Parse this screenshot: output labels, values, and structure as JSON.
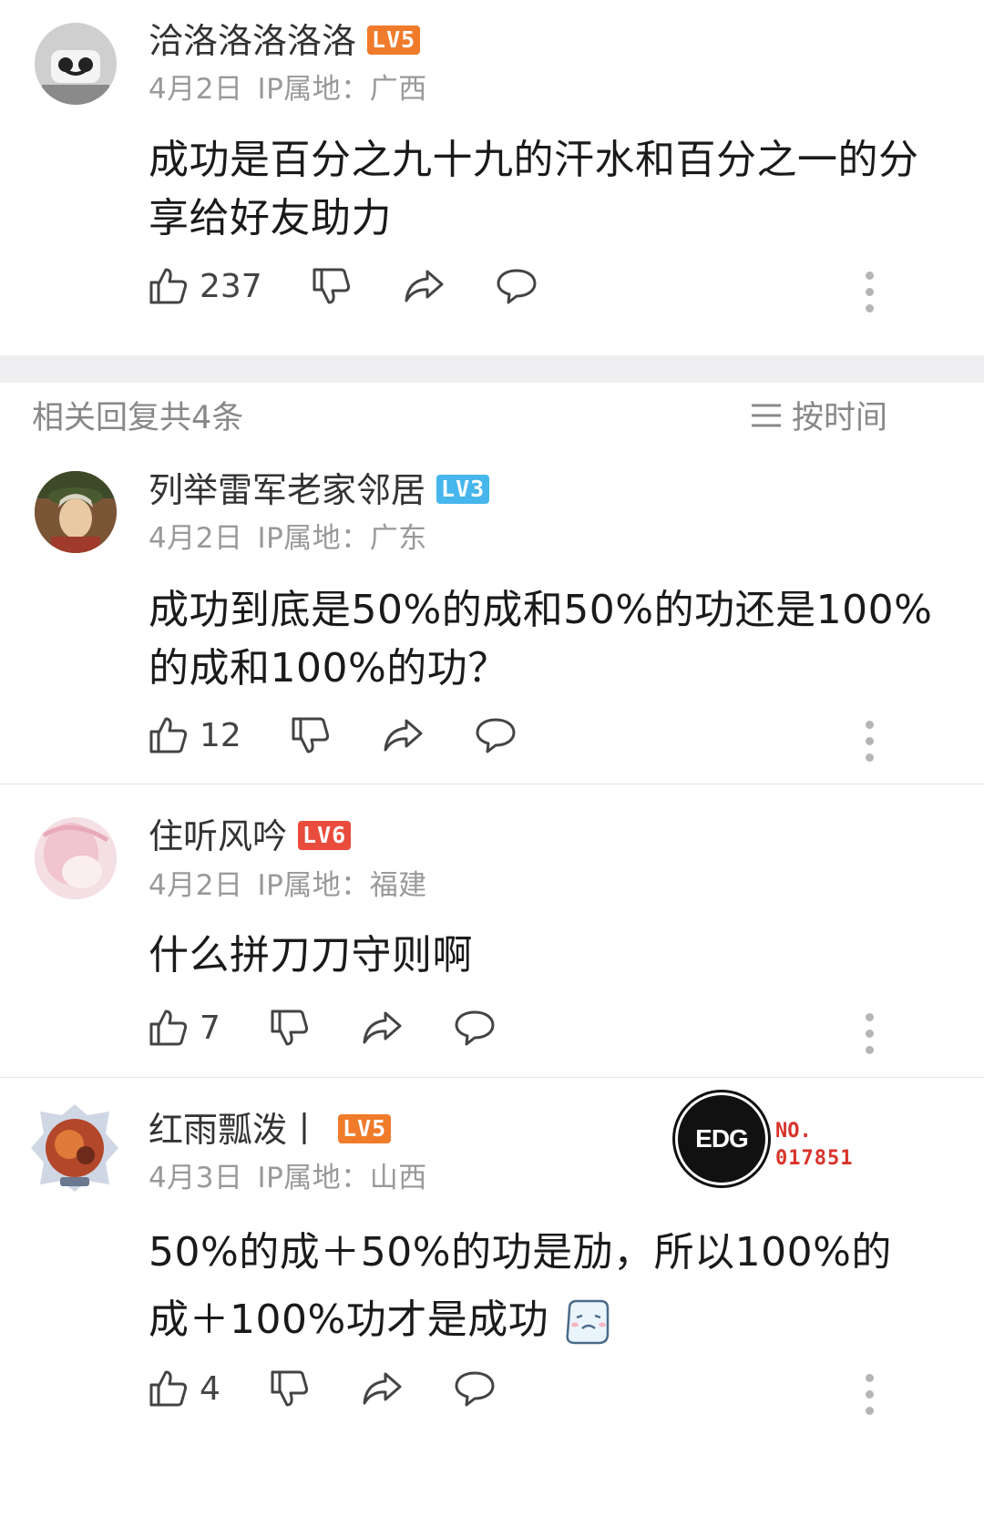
{
  "top_comment": {
    "username": "洽洛洛洛洛洛",
    "level": "LV5",
    "date": "4月2日",
    "ip_location": "IP属地：广西",
    "text": "成功是百分之九十九的汗水和百分之一的分享给好友助力",
    "likes": "237"
  },
  "replies_header": {
    "count_label": "相关回复共4条",
    "sort_label": "按时间"
  },
  "replies": [
    {
      "username": "列举雷军老家邻居",
      "level": "LV3",
      "date": "4月2日",
      "ip_location": "IP属地：广东",
      "text": "成功到底是50%的成和50%的功还是100%的成和100%的功？",
      "likes": "12"
    },
    {
      "username": "住听风吟",
      "level": "LV6",
      "date": "4月2日",
      "ip_location": "IP属地：福建",
      "text": "什么拼刀刀守则啊",
      "likes": "7"
    },
    {
      "username": "红雨瓢泼丨",
      "level": "LV5",
      "date": "4月3日",
      "ip_location": "IP属地：山西",
      "text": "50%的成＋50%的功是劢，所以100%的成＋100%功才是成功",
      "likes": "4",
      "badge_logo_text": "EDG",
      "badge_no_label": "NO.",
      "badge_no_value": "017851"
    }
  ],
  "colors": {
    "lv5": "#f07b2b",
    "lv3": "#46b6ec",
    "lv6": "#e94b3c",
    "badge_red": "#d8332a"
  },
  "icons": [
    "thumbs-up-icon",
    "thumbs-down-icon",
    "share-icon",
    "comment-icon",
    "more-icon",
    "sort-icon",
    "emoji-icon"
  ]
}
